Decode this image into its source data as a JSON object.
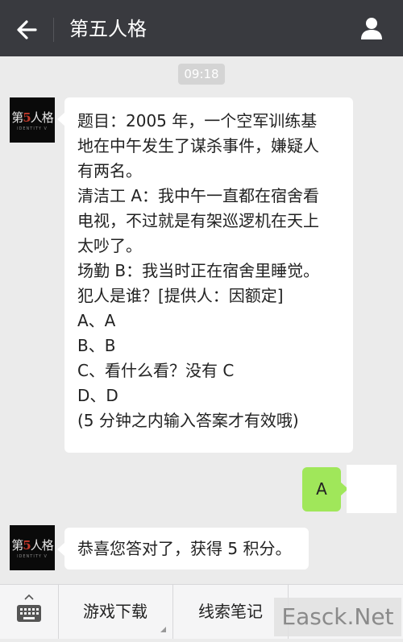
{
  "header": {
    "title": "第五人格",
    "back_icon": "arrow-left-icon",
    "profile_icon": "person-icon"
  },
  "timestamp": "09:18",
  "avatar_logo": {
    "main": "第5人格",
    "sub": "IDENTITY V"
  },
  "messages": [
    {
      "sender": "official",
      "lines": [
        "题目：2005 年，一个空军训练基",
        "地在中午发生了谋杀事件，嫌疑人",
        "有两名。",
        "清洁工 A：我中午一直都在宿舍看",
        "电视，不过就是有架巡逻机在天上",
        "太吵了。",
        "场勤 B：我当时正在宿舍里睡觉。",
        "犯人是谁？[提供人：因额定]",
        "A、A",
        "B、B",
        "C、看什么看？没有 C",
        "D、D",
        "(5 分钟之内输入答案才有效哦)"
      ]
    },
    {
      "sender": "me",
      "text": "A"
    },
    {
      "sender": "official",
      "lines": [
        "恭喜您答对了，获得 5 积分。"
      ]
    }
  ],
  "bottom_menu": {
    "keyboard_icon": "keyboard-icon",
    "items": [
      {
        "label": "游戏下载"
      },
      {
        "label": "线索笔记"
      }
    ]
  },
  "watermark": "Easck.Net",
  "colors": {
    "header_bg": "#393a3f",
    "chat_bg": "#ebebeb",
    "my_bubble": "#a0e75a",
    "their_bubble": "#ffffff"
  }
}
